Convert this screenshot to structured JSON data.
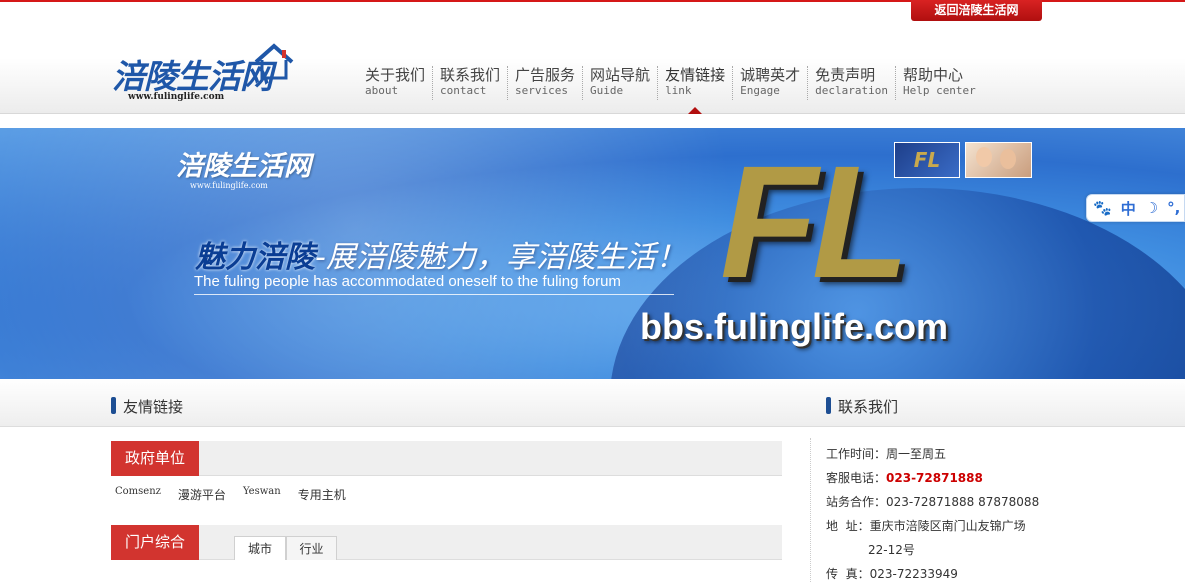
{
  "topbar": {
    "back_label": "返回涪陵生活网"
  },
  "logo": {
    "title": "涪陵生活网",
    "url": "www.fulinglife.com"
  },
  "nav": [
    {
      "cn": "关于我们",
      "en": "about"
    },
    {
      "cn": "联系我们",
      "en": "contact"
    },
    {
      "cn": "广告服务",
      "en": "services"
    },
    {
      "cn": "网站导航",
      "en": "Guide"
    },
    {
      "cn": "友情链接",
      "en": "link"
    },
    {
      "cn": "诚聘英才",
      "en": "Engage"
    },
    {
      "cn": "免责声明",
      "en": "declaration"
    },
    {
      "cn": "帮助中心",
      "en": "Help center"
    }
  ],
  "banner": {
    "logo": "涪陵生活网",
    "url": "www.fulinglife.com",
    "slogan_bold": "魅力涪陵",
    "slogan_rest": "-展涪陵魅力，享涪陵生活！",
    "english": "The fuling people has accommodated oneself to the fuling forum",
    "big_letters": "FL",
    "site": "bbs.fulinglife.com",
    "thumb_text": "FL"
  },
  "ime": {
    "mode": "中"
  },
  "sections": {
    "links_title": "友情链接",
    "contact_title": "联系我们"
  },
  "categories": {
    "gov_label": "政府单位",
    "gov_links": [
      "Comsenz",
      "漫游平台",
      "Yeswan",
      "专用主机"
    ],
    "portal_label": "门户综合",
    "portal_tabs": [
      "城市",
      "行业"
    ]
  },
  "contact": {
    "hours": "工作时间：周一至周五",
    "service_label": "客服电话：",
    "service_phone": "023-72871888",
    "coop": "站务合作：023-72871888 87878088",
    "address": "地  址：重庆市涪陵区南门山友锦广场",
    "address2": "22-12号",
    "fax": "传  真：023-72233949"
  }
}
